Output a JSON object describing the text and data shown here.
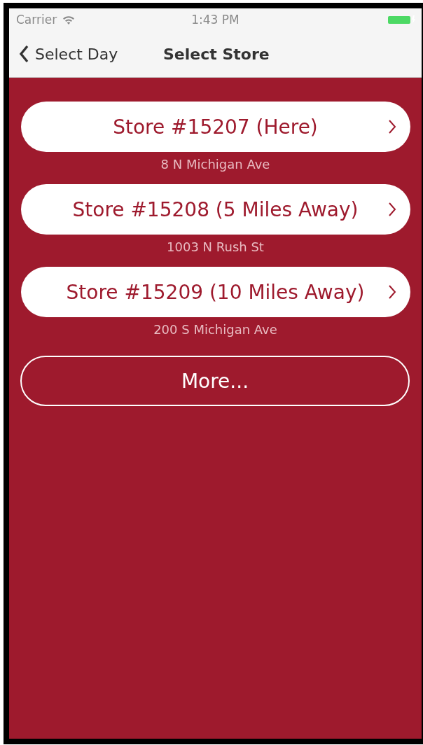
{
  "status_bar": {
    "carrier": "Carrier",
    "time": "1:43 PM"
  },
  "nav": {
    "back": "Select Day",
    "title": "Select Store"
  },
  "stores": [
    {
      "name": "Store #15207 (Here)",
      "address": "8 N Michigan Ave"
    },
    {
      "name": "Store #15208 (5 Miles Away)",
      "address": "1003 N Rush St"
    },
    {
      "name": "Store #15209 (10 Miles Away)",
      "address": "200 S Michigan Ave"
    }
  ],
  "more_button": "More..."
}
